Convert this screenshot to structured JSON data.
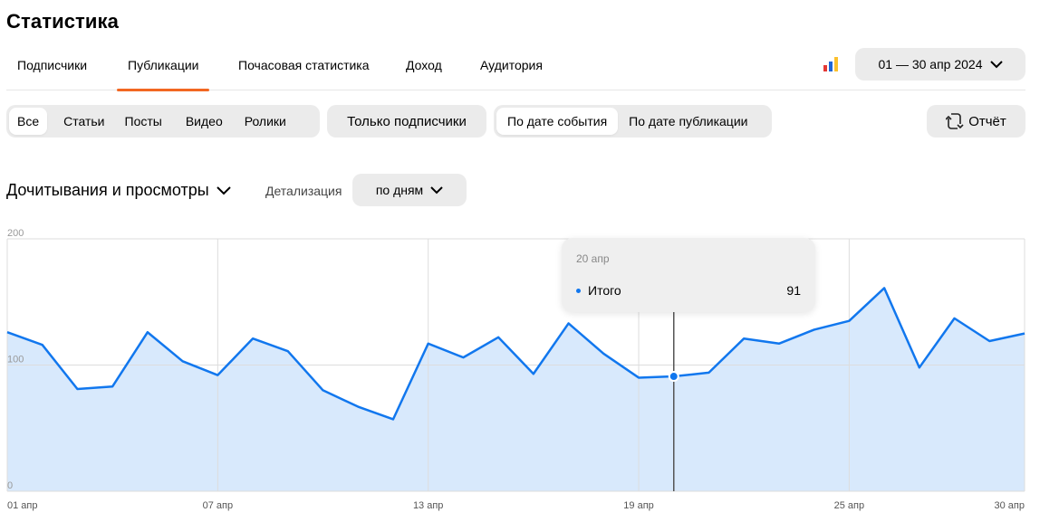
{
  "page": {
    "title": "Статистика"
  },
  "tabs": [
    {
      "label": "Подписчики"
    },
    {
      "label": "Публикации",
      "active": true
    },
    {
      "label": "Почасовая статистика"
    },
    {
      "label": "Доход"
    },
    {
      "label": "Аудитория"
    }
  ],
  "date_range": {
    "label": "01 — 30 апр 2024"
  },
  "content_filter": [
    "Все",
    "Статьи",
    "Посты",
    "Видео",
    "Ролики"
  ],
  "content_filter_selected": "Все",
  "subscribers_only": {
    "label": "Только подписчики"
  },
  "date_mode": [
    "По дате события",
    "По дате публикации"
  ],
  "date_mode_selected": "По дате события",
  "report": {
    "label": "Отчёт"
  },
  "metric_selector": {
    "label": "Дочитывания и просмотры"
  },
  "detail": {
    "label": "Детализация",
    "value": "по дням"
  },
  "tooltip": {
    "date": "20 апр",
    "series": "Итого",
    "value": "91"
  },
  "colors": {
    "accent": "#f26722",
    "line": "#1177ee",
    "fill": "#d8e9fc",
    "pill_bg": "#ebebeb"
  },
  "chart_data": {
    "type": "area",
    "title": "",
    "ylim": [
      0,
      200
    ],
    "y_ticks": [
      "200",
      "100",
      "0"
    ],
    "x_tick_labels": [
      "01 апр",
      "07 апр",
      "13 апр",
      "19 апр",
      "25 апр",
      "30 апр"
    ],
    "x": [
      "01 апр",
      "02 апр",
      "03 апр",
      "04 апр",
      "05 апр",
      "06 апр",
      "07 апр",
      "08 апр",
      "09 апр",
      "10 апр",
      "11 апр",
      "12 апр",
      "13 апр",
      "14 апр",
      "15 апр",
      "16 апр",
      "17 апр",
      "18 апр",
      "19 апр",
      "20 апр",
      "21 апр",
      "22 апр",
      "23 апр",
      "24 апр",
      "25 апр",
      "26 апр",
      "27 апр",
      "28 апр",
      "29 апр",
      "30 апр"
    ],
    "series": [
      {
        "name": "Итого",
        "values": [
          126,
          116,
          81,
          83,
          126,
          103,
          92,
          121,
          111,
          80,
          67,
          57,
          117,
          106,
          122,
          93,
          133,
          109,
          90,
          91,
          94,
          121,
          117,
          128,
          135,
          161,
          98,
          137,
          119,
          125
        ]
      }
    ],
    "highlighted_index": 19,
    "grid": true
  }
}
